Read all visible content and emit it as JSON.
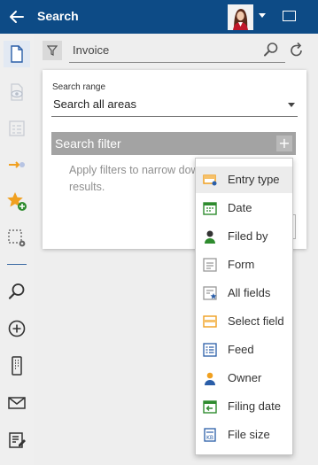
{
  "header": {
    "title": "Search"
  },
  "search": {
    "query": "Invoice"
  },
  "panel": {
    "range_label": "Search range",
    "range_value": "Search all areas",
    "filter_title": "Search filter",
    "add_symbol": "+",
    "hint": "Apply filters to narrow down results."
  },
  "menu": {
    "items": [
      {
        "label": "Entry type",
        "icon": "entry-type-icon"
      },
      {
        "label": "Date",
        "icon": "calendar-icon"
      },
      {
        "label": "Filed by",
        "icon": "user-icon"
      },
      {
        "label": "Form",
        "icon": "form-icon"
      },
      {
        "label": "All fields",
        "icon": "all-fields-icon"
      },
      {
        "label": "Select field",
        "icon": "select-field-icon"
      },
      {
        "label": "Feed",
        "icon": "feed-icon"
      },
      {
        "label": "Owner",
        "icon": "owner-icon"
      },
      {
        "label": "Filing date",
        "icon": "filing-date-icon"
      },
      {
        "label": "File size",
        "icon": "file-size-icon"
      }
    ]
  },
  "colors": {
    "header": "#0d4b86",
    "accent_orange": "#f0a020",
    "accent_green": "#2e8b2e",
    "accent_blue": "#2a5ea8"
  }
}
